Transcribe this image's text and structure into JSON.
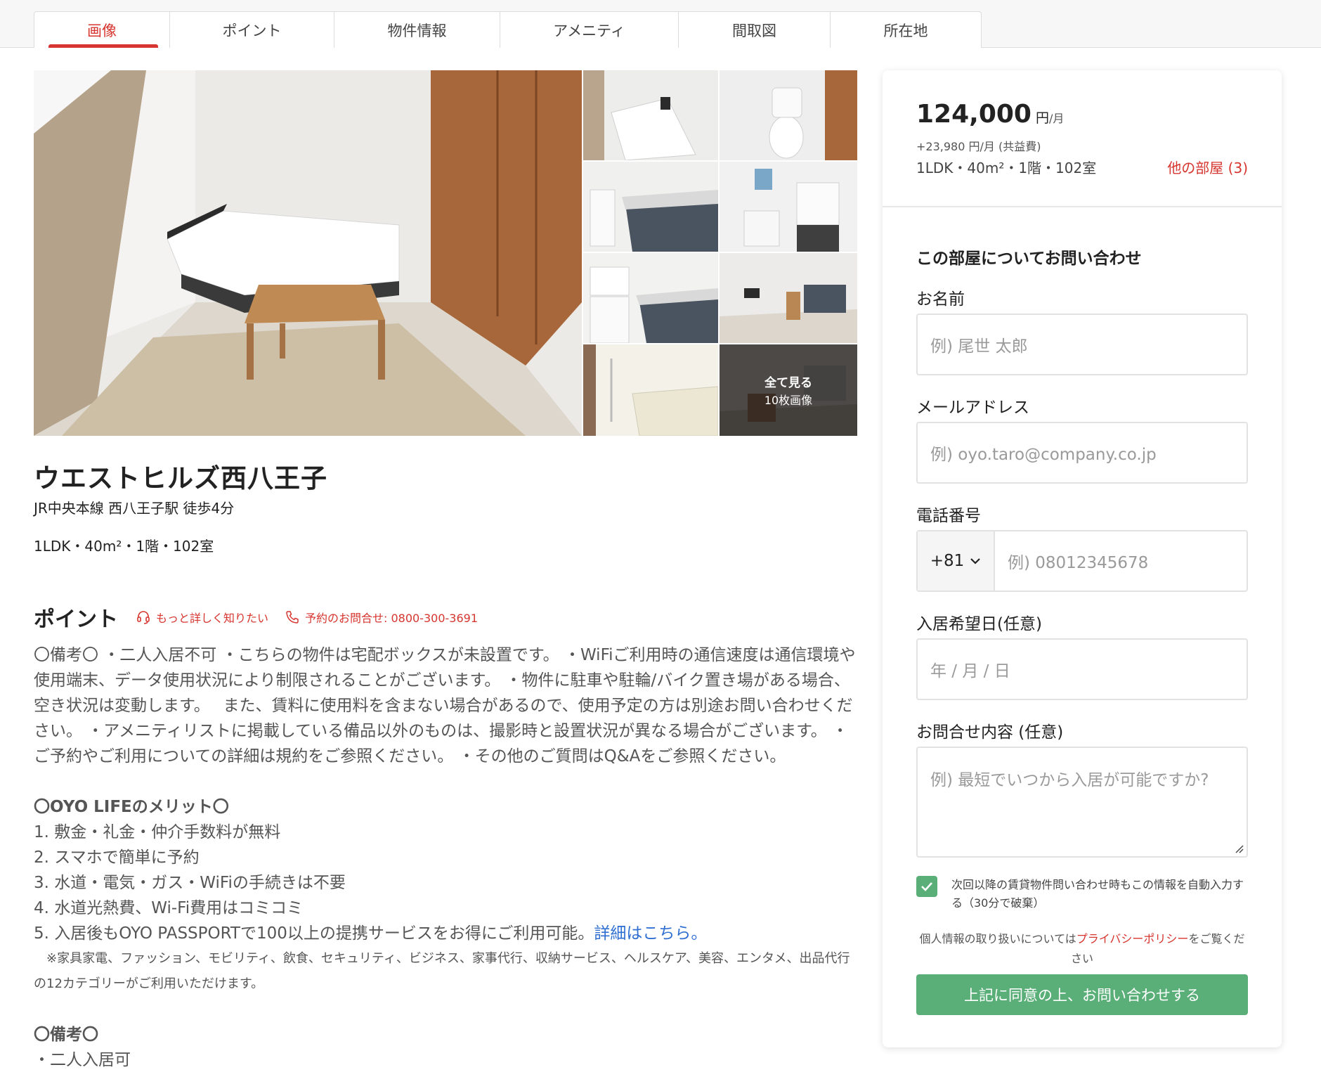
{
  "tabs": [
    {
      "label": "画像",
      "active": true
    },
    {
      "label": "ポイント"
    },
    {
      "label": "物件情報"
    },
    {
      "label": "アメニティ"
    },
    {
      "label": "間取図"
    },
    {
      "label": "所在地"
    }
  ],
  "gallery": {
    "see_all": "全て見る",
    "count": "10枚画像"
  },
  "property": {
    "name": "ウエストヒルズ西八王子",
    "station": "JR中央本線 西八王子駅 徒歩4分",
    "room_info": "1LDK・40m²・1階・102室"
  },
  "point": {
    "title": "ポイント",
    "link_more": "もっと詳しく知りたい",
    "link_phone": "予約のお問合せ: 0800-300-3691",
    "paragraph1": "〇備考〇 ・二人入居不可 ・こちらの物件は宅配ボックスが未設置です。 ・WiFiご利用時の通信速度は通信環境や使用端末、データ使用状況により制限されることがございます。 ・物件に駐車や駐輪/バイク置き場がある場合、空き状況は変動します。　 また、賃料に使用料を含まない場合があるので、使用予定の方は別途お問い合わせください。 ・アメニティリストに掲載している備品以外のものは、撮影時と設置状況が異なる場合がございます。 ・ご予約やご利用についての詳細は規約をご参照ください。 ・その他のご質問はQ&Aをご参照ください。",
    "merit_title": "〇OYO LIFEのメリット〇",
    "merit1": "1. 敷金・礼金・仲介手数料が無料",
    "merit2": "2. スマホで簡単に予約",
    "merit3": "3. 水道・電気・ガス・WiFiの手続きは不要",
    "merit4": "4. 水道光熱費、Wi-Fi費用はコミコミ",
    "merit5": "5. 入居後もOYO PASSPORTで100以上の提携サービスをお得にご利用可能。",
    "merit5_link": "詳細はこちら。",
    "note": "　※家具家電、ファッション、モビリティ、飲食、セキュリティ、ビジネス、家事代行、収納サービス、ヘルスケア、美容、エンタメ、出品代行の12カテゴリーがご利用いただけます。",
    "remarks_title": "〇備考〇",
    "remarks1": "・二人入居可"
  },
  "card": {
    "price": "124,000",
    "price_unit": "円",
    "price_per": "/月",
    "fee": "+23,980 円/月 (共益費)",
    "info": "1LDK・40m²・1階・102室",
    "other_rooms": "他の部屋 (3)",
    "form_title": "この部屋についてお問い合わせ",
    "name_label": "お名前",
    "name_placeholder": "例) 尾世 太郎",
    "email_label": "メールアドレス",
    "email_placeholder": "例) oyo.taro@company.co.jp",
    "phone_label": "電話番号",
    "country_code": "+81",
    "phone_placeholder": "例) 08012345678",
    "date_label": "入居希望日(任意)",
    "date_placeholder": "年 / 月 / 日",
    "message_label": "お問合せ内容 (任意)",
    "message_placeholder": "例) 最短でいつから入居が可能ですか?",
    "remember_text": "次回以降の賃貸物件問い合わせ時もこの情報を自動入力する（30分で破棄）",
    "privacy_before": "個人情報の取り扱いについては",
    "privacy_link": "プライバシーポリシー",
    "privacy_after": "をご覧ください",
    "submit": "上記に同意の上、お問い合わせする"
  },
  "colors": {
    "accent_red": "#d7352f",
    "button_green": "#5aae78",
    "link_blue": "#2f6fd1"
  }
}
